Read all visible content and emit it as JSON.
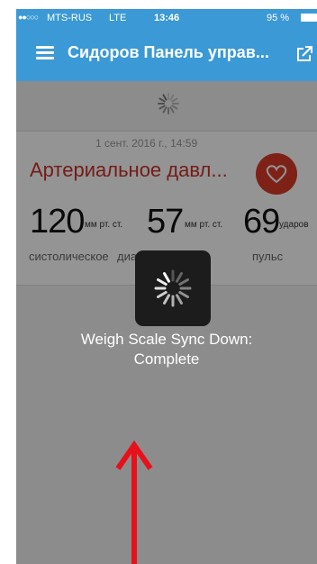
{
  "status_bar": {
    "signal_dots": "●●○○○",
    "carrier": "MTS-RUS",
    "network": "LTE",
    "time": "13:46",
    "battery_percent": "95 %"
  },
  "nav": {
    "title": "Сидоров Панель управ...",
    "menu_icon": "hamburger-menu-icon",
    "share_icon": "share-icon"
  },
  "card": {
    "date": "1 сент. 2016 г., 14:59",
    "title": "Артериальное давл...",
    "systolic": {
      "value": "120",
      "unit": "мм рт. ст.",
      "label": "систолическое"
    },
    "diastolic": {
      "value": "57",
      "unit": "мм рт. ст.",
      "label": "диастолическое"
    },
    "pulse": {
      "value": "69",
      "unit": "ударов",
      "label": "пульс"
    },
    "heart_icon": "heart-icon"
  },
  "hud": {
    "line1": "Weigh Scale Sync Down:",
    "line2": "Complete"
  },
  "colors": {
    "nav_blue": "#3b99d6",
    "accent_red": "#c8312a",
    "arrow_red": "#e8101a"
  }
}
